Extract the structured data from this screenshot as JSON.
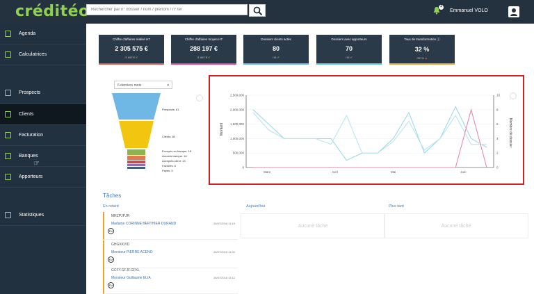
{
  "app": {
    "logo": "créditéo"
  },
  "search": {
    "placeholder": "Rechercher par n° dossier / nom / prénom / n° tel"
  },
  "header": {
    "notif_count": "4",
    "username": "Emmanuel VOLO"
  },
  "sidebar": {
    "items": [
      {
        "label": "Agenda"
      },
      {
        "label": "Calculatrices"
      },
      {
        "label": "Prospects"
      },
      {
        "label": "Clients"
      },
      {
        "label": "Facturation"
      },
      {
        "label": "Banques"
      },
      {
        "label": "Apporteurs"
      },
      {
        "label": "Statistiques"
      }
    ]
  },
  "kpis": [
    {
      "title": "Chiffre d'affaires réalisé HT",
      "value": "2 305 575 €",
      "sub": "/1 667 €",
      "color": "#e25656"
    },
    {
      "title": "Chiffre d'affaires moyen HT",
      "value": "288 197 €",
      "sub": "/1 667 €",
      "color": "#e84393"
    },
    {
      "title": "Dossiers clients actés",
      "value": "80",
      "sub": "/15",
      "color": "#6fb1e8"
    },
    {
      "title": "Dossiers avec apporteurs",
      "value": "70",
      "sub": "/15",
      "color": "#5ec6d8"
    },
    {
      "title": "Taux de transformation",
      "value": "32 %",
      "sub": "/20 %",
      "color": "#f0a030"
    }
  ],
  "funnel": {
    "select": "6 derniers mois",
    "labels": [
      "Prospects: 81",
      "Clients: 80",
      "Envoyés en banque: 18",
      "Accords banque: 16",
      "Acceptés client: 13",
      "Facturés: 6",
      "Payés: 5"
    ]
  },
  "chart_data": {
    "type": "line",
    "ylabel": "Montant",
    "y2label": "Nombre de dossier",
    "y_ticks": [
      "2,500,000",
      "2,000,000",
      "1,500,000",
      "1,000,000",
      "500,000",
      "0"
    ],
    "y2_ticks": [
      "10",
      "8",
      "6",
      "4",
      "2",
      "0"
    ],
    "x_ticks": [
      "Mars",
      "Avril",
      "Mai",
      "Juin"
    ],
    "ylim": [
      0,
      2500000
    ],
    "y2lim": [
      0,
      10
    ],
    "series": [
      {
        "name": "",
        "color": "#9ed8ec",
        "axis": "left",
        "values": [
          2000000,
          1500000,
          1000000,
          1000000,
          1000000,
          1000000,
          250000,
          500000,
          500000,
          1000000,
          1900000,
          500000,
          1000000,
          2100000,
          1000000,
          700000
        ]
      },
      {
        "name": "",
        "color": "#b8e4f0",
        "axis": "left",
        "values": [
          1900000,
          1300000,
          1000000,
          1000000,
          1000000,
          800000,
          1800000,
          500000,
          500000,
          900000,
          1600000,
          600000,
          1000000,
          1800000,
          800000,
          800000
        ]
      },
      {
        "name": "",
        "color": "#e78ab0",
        "axis": "right",
        "values": [
          0,
          0,
          0,
          0,
          0,
          0,
          0,
          0,
          0,
          0,
          0,
          0,
          0,
          0,
          8,
          0
        ]
      }
    ]
  },
  "tasks": {
    "title": "Tâches",
    "col_late": "En retard",
    "col_today": "Aujourd'hui",
    "col_later": "Plus tard",
    "empty": "Aucune tâche",
    "items": [
      {
        "ref": "MRZPJPJR",
        "who": "Madame CORINNE BERTHIER DURAND",
        "date": "26/07/2018 11:15",
        "av": "EV"
      },
      {
        "ref": "GHGXKVID",
        "who": "Monsieur PIERRE ACENO",
        "date": "26/07/2018 11:00",
        "av": "EV"
      },
      {
        "ref": "GCFY.GFJF.GFKL",
        "who": "Monsieur Guillaume ELIA",
        "date": "26/07/2018 11:12",
        "av": "EV"
      }
    ]
  }
}
